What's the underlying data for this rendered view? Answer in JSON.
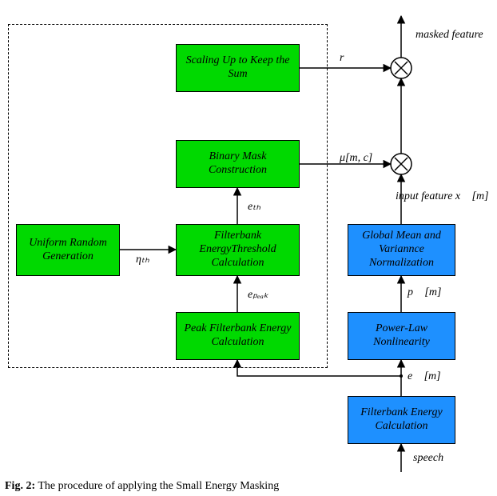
{
  "diagram": {
    "boxes": {
      "uniform_random": "Uniform Random\nGeneration",
      "scaling_up": "Scaling Up to\nKeep the Sum",
      "binary_mask": "Binary Mask\nConstruction",
      "energy_threshold": "Filterbank\nEnergyThreshold\nCalculation",
      "peak_filterbank": "Peak Filterbank\nEnergy Calculation",
      "global_mean": "Global Mean and\nVariannce\nNormalization",
      "power_law": "Power-Law\nNonlinearity",
      "filterbank_energy": "Filterbank\nEnergy Calculation"
    },
    "labels": {
      "masked_feature": "masked feature",
      "r": "r",
      "mu_mc": "μ[m, c]",
      "input_feature": "input feature x⃗ [m]",
      "e_th": "eₜₕ",
      "eta_th": "ηₜₕ",
      "e_peak": "eₚₑₐₖ",
      "p_m": "p⃗ [m]",
      "e_m": "e⃗ [m]",
      "speech": "speech"
    },
    "caption_prefix": "Fig. 2:",
    "caption_text": "The procedure of applying the Small Energy Masking"
  }
}
